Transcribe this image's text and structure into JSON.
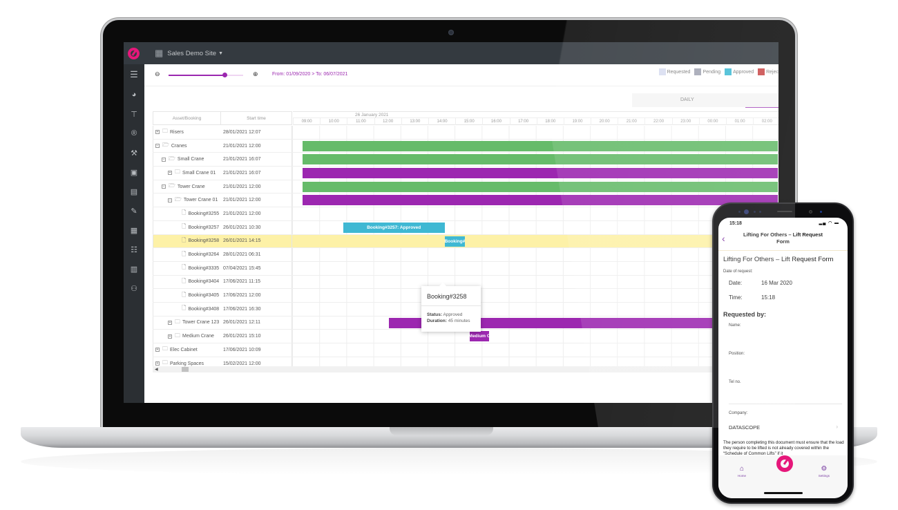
{
  "app": {
    "site_name": "Sales Demo Site",
    "site_icon": "building-icon"
  },
  "sidebar": {
    "items": [
      {
        "icon": "menu-icon",
        "glyph": "☰"
      },
      {
        "icon": "pie-chart-icon",
        "glyph": "◕"
      },
      {
        "icon": "crane-icon",
        "glyph": "⊤"
      },
      {
        "icon": "registered-icon",
        "glyph": "®"
      },
      {
        "icon": "wrench-icon",
        "glyph": "⚒"
      },
      {
        "icon": "calendar-icon",
        "glyph": "▣"
      },
      {
        "icon": "clipboard-icon",
        "glyph": "▤"
      },
      {
        "icon": "edit-document-icon",
        "glyph": "✎"
      },
      {
        "icon": "calendar-edit-icon",
        "glyph": "▦"
      },
      {
        "icon": "task-list-icon",
        "glyph": "☷"
      },
      {
        "icon": "book-icon",
        "glyph": "▥"
      },
      {
        "icon": "user-settings-icon",
        "glyph": "⚇"
      }
    ]
  },
  "toolbar": {
    "zoom_out_icon": "🔍",
    "zoom_in_icon": "🔍",
    "zoom_level": 0.75,
    "date_range": "From: 01/09/2020 > To: 06/07/2021"
  },
  "legend": [
    {
      "label": "Requested",
      "color": "#d9ddf0"
    },
    {
      "label": "Pending",
      "color": "#a3a6b4"
    },
    {
      "label": "Approved",
      "color": "#43bcd5"
    },
    {
      "label": "Rejec",
      "color": "#c94b4b"
    }
  ],
  "view_tabs": {
    "daily": "DAILY"
  },
  "gantt": {
    "headers": {
      "asset": "Asset/Booking",
      "start": "Start time"
    },
    "date_label": "26 January 2021",
    "hours": [
      "09:00",
      "10:00",
      "11:00",
      "12:00",
      "13:00",
      "14:00",
      "15:00",
      "16:00",
      "17:00",
      "18:00",
      "19:00",
      "20:00",
      "21:00",
      "22:00",
      "23:00",
      "00:00",
      "01:00",
      "02:00"
    ],
    "rows": [
      {
        "name": "Risers",
        "start": "28/01/2021 12:07",
        "level": 0,
        "type": "folder",
        "expander": "+"
      },
      {
        "name": "Cranes",
        "start": "21/01/2021 12:00",
        "level": 0,
        "type": "folder-open",
        "expander": "−"
      },
      {
        "name": "Small Crane",
        "start": "21/01/2021 16:07",
        "level": 1,
        "type": "folder-open",
        "expander": "−"
      },
      {
        "name": "Small Crane 01",
        "start": "21/01/2021 16:07",
        "level": 2,
        "type": "folder",
        "expander": "+"
      },
      {
        "name": "Tower Crane",
        "start": "21/01/2021 12:00",
        "level": 1,
        "type": "folder-open",
        "expander": "−"
      },
      {
        "name": "Tower Crane 01",
        "start": "21/01/2021 12:00",
        "level": 2,
        "type": "folder-open",
        "expander": "−"
      },
      {
        "name": "Booking#3255",
        "start": "21/01/2021 12:00",
        "level": 3,
        "type": "file"
      },
      {
        "name": "Booking#3257",
        "start": "26/01/2021 10:30",
        "level": 3,
        "type": "file"
      },
      {
        "name": "Booking#3258",
        "start": "26/01/2021 14:15",
        "level": 3,
        "type": "file",
        "selected": true
      },
      {
        "name": "Booking#3264",
        "start": "28/01/2021 06:31",
        "level": 3,
        "type": "file"
      },
      {
        "name": "Booking#3335",
        "start": "07/04/2021 15:45",
        "level": 3,
        "type": "file"
      },
      {
        "name": "Booking#3404",
        "start": "17/06/2021 11:15",
        "level": 3,
        "type": "file"
      },
      {
        "name": "Booking#3405",
        "start": "17/06/2021 12:00",
        "level": 3,
        "type": "file"
      },
      {
        "name": "Booking#3408",
        "start": "17/06/2021 16:30",
        "level": 3,
        "type": "file"
      },
      {
        "name": "Tower Crane 123",
        "start": "26/01/2021 12:11",
        "level": 2,
        "type": "folder",
        "expander": "+"
      },
      {
        "name": "Medium Crane",
        "start": "26/01/2021 15:10",
        "level": 2,
        "type": "folder",
        "expander": "+"
      },
      {
        "name": "Elec Cabinet",
        "start": "17/06/2021 10:09",
        "level": 0,
        "type": "folder",
        "expander": "+"
      },
      {
        "name": "Parking Spaces",
        "start": "15/02/2021 12:00",
        "level": 0,
        "type": "folder",
        "expander": "+"
      }
    ],
    "bars": [
      {
        "row": 1,
        "start_hour": 9.0,
        "end_hour": 26.8,
        "color": "#66bb6a",
        "label": ""
      },
      {
        "row": 2,
        "start_hour": 9.0,
        "end_hour": 26.8,
        "color": "#66bb6a",
        "label": ""
      },
      {
        "row": 3,
        "start_hour": 9.0,
        "end_hour": 26.8,
        "color": "#9c27b0",
        "label": ""
      },
      {
        "row": 4,
        "start_hour": 9.0,
        "end_hour": 26.8,
        "color": "#66bb6a",
        "label": ""
      },
      {
        "row": 5,
        "start_hour": 9.0,
        "end_hour": 26.8,
        "color": "#9c27b0",
        "label": ""
      },
      {
        "row": 7,
        "start_hour": 10.5,
        "end_hour": 14.25,
        "color": "#3fb8d3",
        "label": "Booking#3257: Approved"
      },
      {
        "row": 8,
        "start_hour": 14.25,
        "end_hour": 15.0,
        "color": "#3fb8d3",
        "label": "Booking#"
      },
      {
        "row": 14,
        "start_hour": 12.18,
        "end_hour": 26.8,
        "color": "#9c27b0",
        "label": ""
      },
      {
        "row": 15,
        "start_hour": 15.17,
        "end_hour": 15.9,
        "color": "#9c27b0",
        "label": "Medium C"
      }
    ],
    "tooltip": {
      "title": "Booking#3258",
      "status_label": "Status:",
      "status": "Approved",
      "duration_label": "Duration:",
      "duration": "45 minutes"
    }
  },
  "phone": {
    "status_time": "15:18",
    "status_icons": "▂▄ ◠ ▬",
    "nav_title": "Lifting For Others – Lift Request Form",
    "form_title": "Lifting For Others – Lift Request Form",
    "date_of_request_label": "Date of request:",
    "date_label": "Date:",
    "date_value": "16 Mar 2020",
    "time_label": "Time:",
    "time_value": "15:18",
    "requested_by": "Requested by:",
    "name_label": "Name:",
    "position_label": "Position:",
    "tel_label": "Tel no.",
    "company_label": "Company:",
    "company_value": "DATASCOPE",
    "paragraph": "The person completing this document must ensure that the load they require to be lifted is not already covered within the “Schedule of Common Lifts” if it",
    "tabs": {
      "home": "Home",
      "settings": "Settings"
    }
  }
}
